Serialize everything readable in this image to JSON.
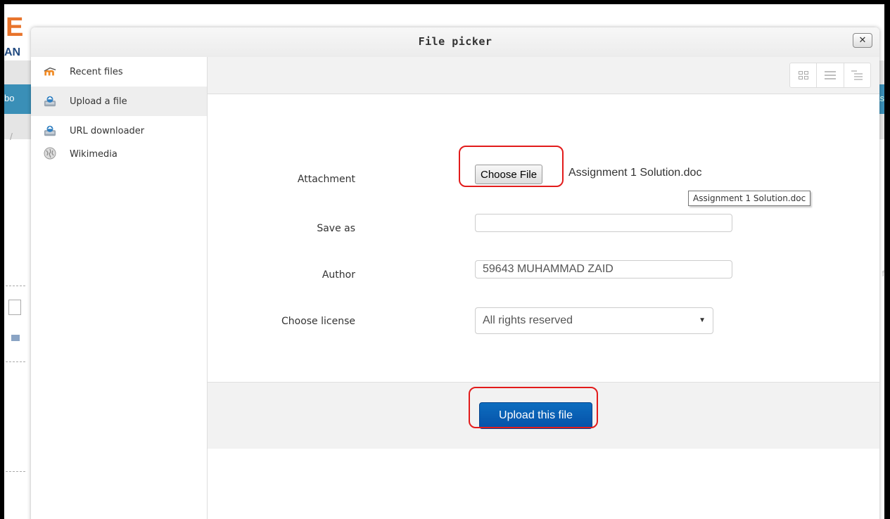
{
  "background": {
    "logo_letter": "E",
    "logo_text": "AN",
    "nav_left_text": "bo",
    "nav_right_text": "as",
    "breadcrumb_text": "/",
    "right_fragment_text": "f"
  },
  "dialog": {
    "title": "File picker",
    "close_label": "✕"
  },
  "sidebar": {
    "items": [
      {
        "label": "Recent files",
        "icon": "moodle-icon"
      },
      {
        "label": "Upload a file",
        "icon": "upload-icon"
      },
      {
        "label": "URL downloader",
        "icon": "url-icon"
      },
      {
        "label": "Wikimedia",
        "icon": "wikimedia-icon"
      }
    ],
    "active_index": 1
  },
  "toolbar": {
    "views": [
      "icons-view",
      "list-view",
      "tree-view"
    ]
  },
  "form": {
    "attachment_label": "Attachment",
    "choose_file_label": "Choose File",
    "chosen_file_name": "Assignment 1 Solution.doc",
    "tooltip_text": "Assignment 1 Solution.doc",
    "save_as_label": "Save as",
    "save_as_value": "",
    "author_label": "Author",
    "author_value": "59643 MUHAMMAD ZAID",
    "license_label": "Choose license",
    "license_value": "All rights reserved"
  },
  "footer": {
    "upload_label": "Upload this file"
  },
  "colors": {
    "primary_button": "#0a5eb3",
    "highlight": "#e21b1b",
    "nav_strip": "#3a8fb7"
  }
}
